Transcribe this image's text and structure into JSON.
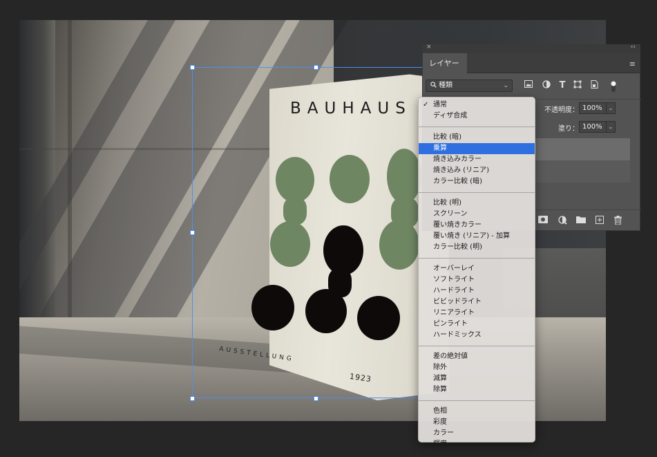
{
  "poster": {
    "title": "BAUHAUS",
    "footer_left": "AUSSTELLUNG",
    "footer_right": "1923"
  },
  "layers_panel": {
    "close_glyph": "×",
    "collapse_glyph": "‹‹",
    "tab_label": "レイヤー",
    "menu_glyph": "≡",
    "filter_kind_label": "種類",
    "opacity_label": "不透明度：",
    "opacity_value": "100%",
    "fill_label": "塗り：",
    "fill_value": "100%",
    "chevron": "⌄"
  },
  "blend_menu": {
    "groups": [
      [
        {
          "label": "通常",
          "checked": true
        },
        {
          "label": "ディザ合成"
        }
      ],
      [
        {
          "label": "比較 (暗)"
        },
        {
          "label": "乗算",
          "selected": true
        },
        {
          "label": "焼き込みカラー"
        },
        {
          "label": "焼き込み (リニア)"
        },
        {
          "label": "カラー比較 (暗)"
        }
      ],
      [
        {
          "label": "比較 (明)"
        },
        {
          "label": "スクリーン"
        },
        {
          "label": "覆い焼きカラー"
        },
        {
          "label": "覆い焼き (リニア) - 加算"
        },
        {
          "label": "カラー比較 (明)"
        }
      ],
      [
        {
          "label": "オーバーレイ"
        },
        {
          "label": "ソフトライト"
        },
        {
          "label": "ハードライト"
        },
        {
          "label": "ビビッドライト"
        },
        {
          "label": "リニアライト"
        },
        {
          "label": "ピンライト"
        },
        {
          "label": "ハードミックス"
        }
      ],
      [
        {
          "label": "差の絶対値"
        },
        {
          "label": "除外"
        },
        {
          "label": "減算"
        },
        {
          "label": "除算"
        }
      ],
      [
        {
          "label": "色相"
        },
        {
          "label": "彩度"
        },
        {
          "label": "カラー"
        },
        {
          "label": "輝度"
        }
      ]
    ]
  },
  "colors": {
    "selection_blue": "#2f6fe0",
    "transform_box": "#4e8ff0",
    "poster_green": "#6f8663",
    "poster_black": "#0e0a09"
  }
}
